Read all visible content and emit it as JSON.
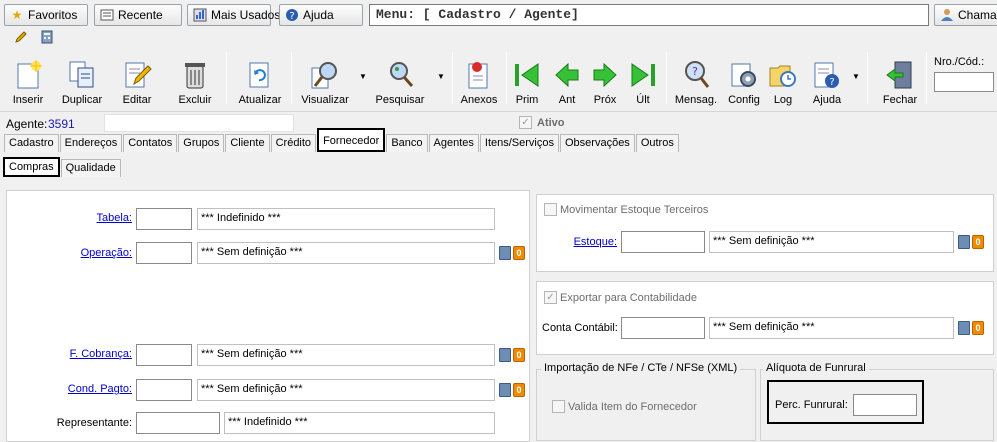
{
  "topbar": {
    "favoritos": "Favoritos",
    "recente": "Recente",
    "mais_usados": "Mais Usados",
    "ajuda": "Ajuda",
    "menu_text": "Menu: [ Cadastro / Agente]",
    "chama": "Chama"
  },
  "toolbar": {
    "inserir": "Inserir",
    "duplicar": "Duplicar",
    "editar": "Editar",
    "excluir": "Excluir",
    "atualizar": "Atualizar",
    "visualizar": "Visualizar",
    "pesquisar": "Pesquisar",
    "anexos": "Anexos",
    "prim": "Prim",
    "ant": "Ant",
    "prox": "Próx",
    "ult": "Últ",
    "mensag": "Mensag.",
    "config": "Config",
    "log": "Log",
    "ajuda": "Ajuda",
    "fechar": "Fechar",
    "nro_label": "Nro./Cód.:"
  },
  "agent": {
    "label": "Agente:",
    "code": "3591",
    "ativo": "Ativo"
  },
  "tabs": [
    "Cadastro",
    "Endereços",
    "Contatos",
    "Grupos",
    "Cliente",
    "Crédito",
    "Fornecedor",
    "Banco",
    "Agentes",
    "Itens/Serviços",
    "Observações",
    "Outros"
  ],
  "subtabs": [
    "Compras",
    "Qualidade"
  ],
  "left": {
    "tabela": "Tabela:",
    "tabela_desc": "*** Indefinido ***",
    "operacao": "Operação:",
    "operacao_desc": "*** Sem definição  ***",
    "cobranca": "F. Cobrança:",
    "cobranca_desc": "*** Sem definição  ***",
    "cond_pagto": "Cond. Pagto:",
    "cond_desc": "*** Sem definição  ***",
    "representante": "Representante:",
    "repr_desc": "*** Indefinido ***"
  },
  "right": {
    "movimentar": "Movimentar Estoque Terceiros",
    "estoque": "Estoque:",
    "estoque_desc": "*** Sem definição  ***",
    "exportar": "Exportar para Contabilidade",
    "conta_contabil": "Conta Contábil:",
    "conta_desc": "*** Sem definição  ***",
    "importacao_legend": "Importação de NFe / CTe / NFSe (XML)",
    "valida": "Valida Item do Fornecedor",
    "aliquota_legend": "Alíquota de Funrural",
    "perc_funrural": "Perc. Funrural:"
  },
  "badge": "0"
}
